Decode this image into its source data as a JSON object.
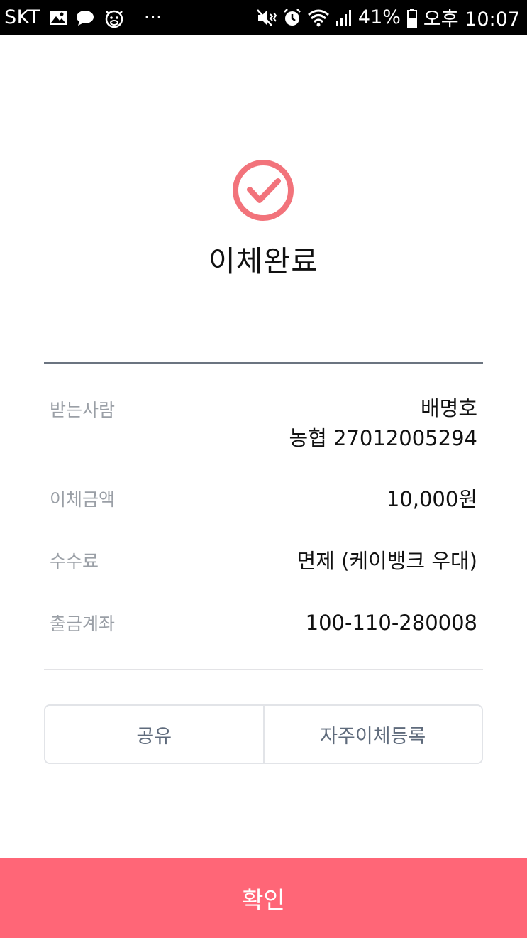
{
  "status_bar": {
    "carrier": "SKT",
    "battery": "41%",
    "time": "오후 10:07",
    "more": "···"
  },
  "result": {
    "title": "이체완료"
  },
  "details": {
    "recipient_label": "받는사람",
    "recipient_name": "배명호",
    "recipient_account": "농협 27012005294",
    "amount_label": "이체금액",
    "amount_value": "10,000원",
    "fee_label": "수수료",
    "fee_value": "면제 (케이뱅크 우대)",
    "source_label": "출금계좌",
    "source_value": "100-110-280008"
  },
  "actions": {
    "share_label": "공유",
    "favorite_label": "자주이체등록",
    "confirm_label": "확인"
  },
  "colors": {
    "accent": "#ff6677",
    "check": "#f2737b",
    "divider": "#6b7480",
    "label": "#9a9fa6",
    "secondary_button_text": "#5f6b7c"
  }
}
